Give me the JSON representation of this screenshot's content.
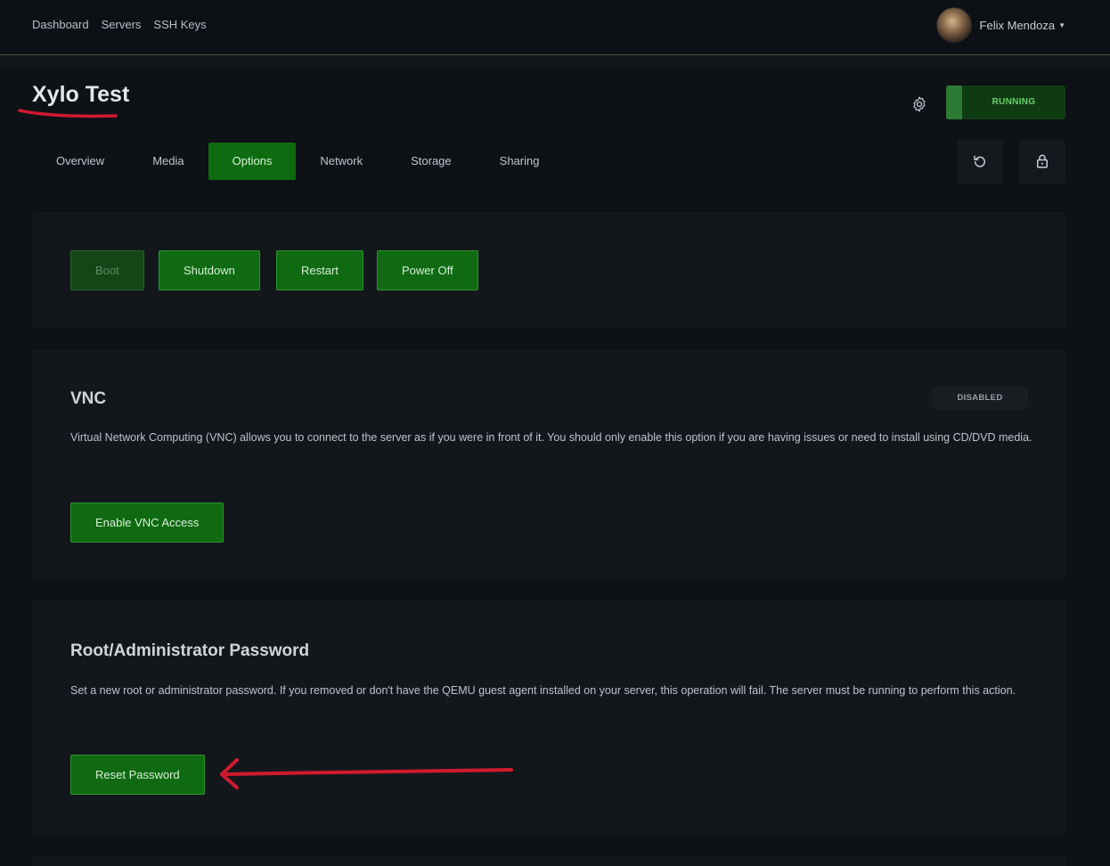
{
  "nav": {
    "links": [
      "Dashboard",
      "Servers",
      "SSH Keys"
    ],
    "user_name": "Felix Mendoza"
  },
  "server": {
    "name": "Xylo Test",
    "status": "RUNNING"
  },
  "tabs": [
    "Overview",
    "Media",
    "Options",
    "Network",
    "Storage",
    "Sharing"
  ],
  "active_tab": "Options",
  "power": {
    "boot": "Boot",
    "shutdown": "Shutdown",
    "restart": "Restart",
    "power_off": "Power Off"
  },
  "vnc": {
    "title": "VNC",
    "status": "DISABLED",
    "description": "Virtual Network Computing (VNC) allows you to connect to the server as if you were in front of it. You should only enable this option if you are having issues or need to install using CD/DVD media.",
    "button": "Enable VNC Access"
  },
  "password": {
    "title": "Root/Administrator Password",
    "description": "Set a new root or administrator password. If you removed or don't have the QEMU guest agent installed on your server, this operation will fail. The server must be running to perform this action.",
    "button": "Reset Password"
  },
  "colors": {
    "accent": "#0e6b10",
    "status_text": "#6cd16f",
    "annotation": "#d01a2e"
  },
  "icons": {
    "settings": "gear-icon",
    "reinstall": "refresh-icon",
    "lock": "unlock-icon",
    "user_menu": "chevron-down-icon"
  }
}
